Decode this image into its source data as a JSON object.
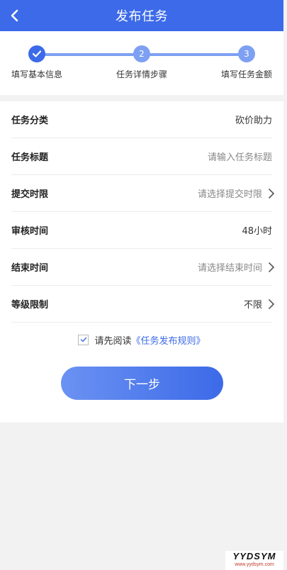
{
  "header": {
    "title": "发布任务"
  },
  "steps": [
    {
      "number": "",
      "label": "填写基本信息",
      "state": "done"
    },
    {
      "number": "2",
      "label": "任务详情步骤",
      "state": "pending"
    },
    {
      "number": "3",
      "label": "填写任务金额",
      "state": "pending"
    }
  ],
  "form": {
    "rows": [
      {
        "label": "任务分类",
        "value": "砍价助力"
      },
      {
        "label": "任务标题",
        "placeholder": "请输入任务标题"
      },
      {
        "label": "提交时限",
        "placeholder": "请选择提交时限"
      },
      {
        "label": "审核时间",
        "value": "48小时"
      },
      {
        "label": "结束时间",
        "placeholder": "请选择结束时间"
      },
      {
        "label": "等级限制",
        "value": "不限"
      }
    ]
  },
  "agreement": {
    "prefix": "请先阅读",
    "link": "《任务发布规则》",
    "checked": true
  },
  "next_button": {
    "label": "下一步"
  },
  "watermark": {
    "brand": "YYDSYM",
    "url": "www.yydsym.com"
  },
  "colors": {
    "primary": "#3c6ae8",
    "step_pending": "#7da0f3",
    "page_bg": "#f2f2f2"
  }
}
